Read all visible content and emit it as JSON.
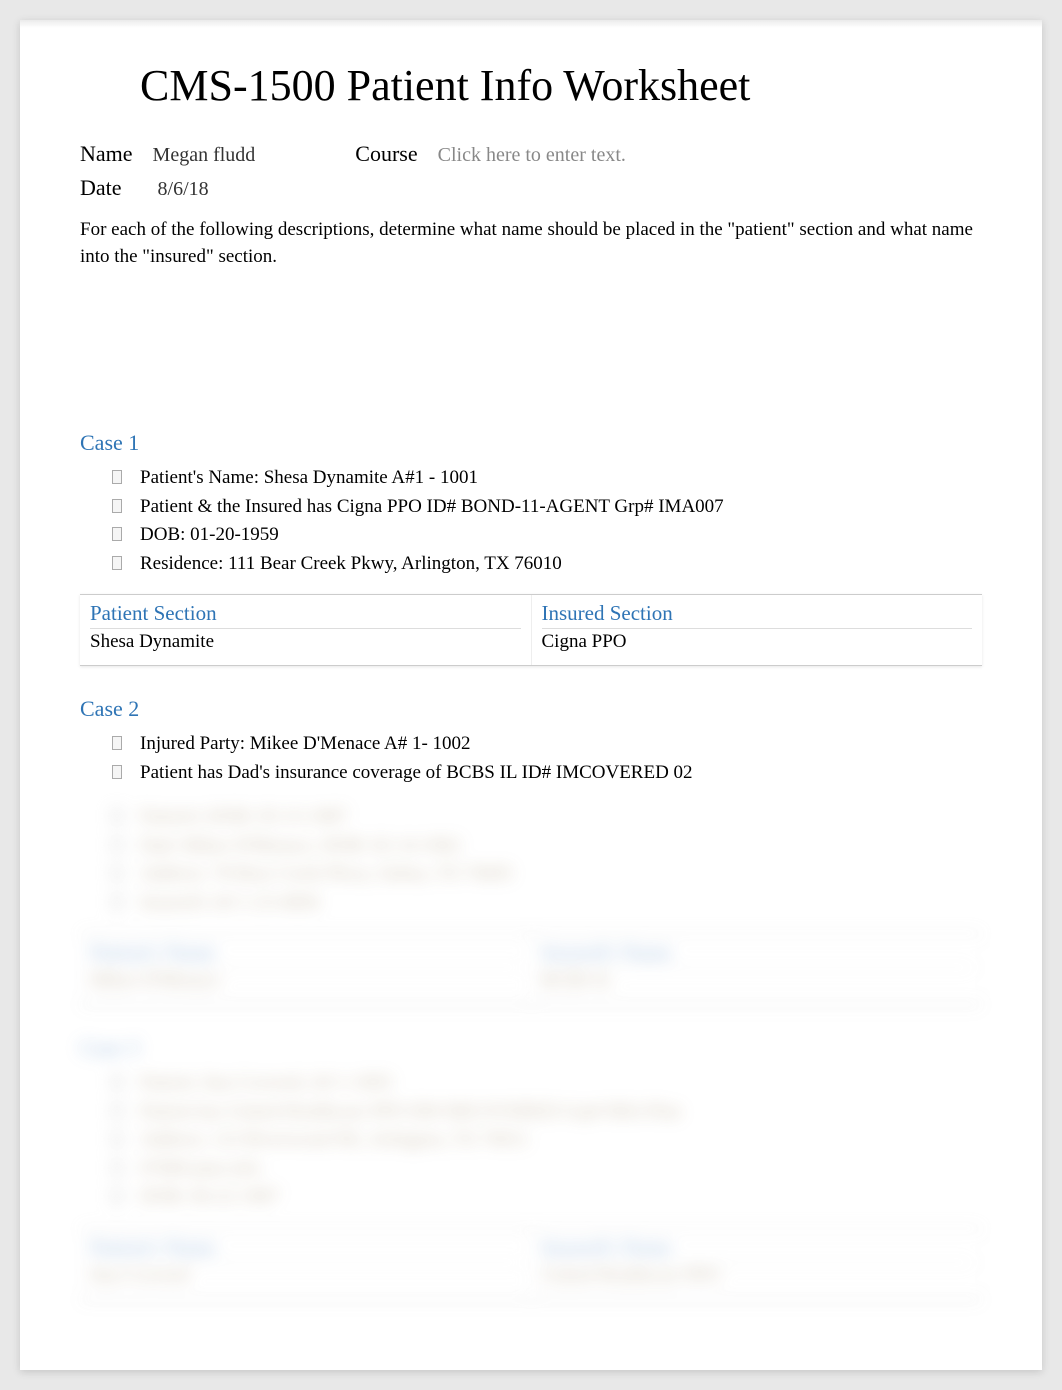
{
  "title": "CMS-1500 Patient Info Worksheet",
  "header": {
    "name_label": "Name",
    "name_value": "Megan fludd",
    "course_label": "Course",
    "course_placeholder": "Click here to enter text.",
    "date_label": "Date",
    "date_value": "8/6/18"
  },
  "instructions": "For each of the following descriptions, determine what name should be placed in the \"patient\" section and what name into the \"insured\" section.",
  "cases": [
    {
      "title": "Case 1",
      "bullets": [
        "Patient's Name:  Shesa  Dynamite    A#1 - 1001",
        "Patient & the Insured has Cigna PPO ID# BOND-11-AGENT  Grp# IMA007",
        "DOB: 01-20-1959",
        "Residence: 111 Bear Creek Pkwy, Arlington, TX 76010"
      ],
      "patient_section_label": "Patient Section",
      "patient_section_value": "Shesa Dynamite",
      "insured_section_label": "Insured Section",
      "insured_section_value": "Cigna PPO"
    },
    {
      "title": "Case 2",
      "bullets": [
        "Injured Party: Mikee D'Menace   A# 1- 1002",
        "Patient has Dad's insurance coverage of BCBS IL ID# IMCOVERED 02"
      ],
      "blurred_bullets": [
        "Patient's DOB: 05-15-1987",
        "Dad: Mikee D'Menace, DOB: 02-14-1962",
        "Address:  78 Bear Creek Pkwy, Salina, TX 76005",
        "Insured's A# 1-23-4094"
      ],
      "patient_section_label": "Patient's Name",
      "patient_section_value": "Mikee D'Menace",
      "insured_section_label": "Insured's Name",
      "insured_section_value": "BCBS IL"
    },
    {
      "title": "Case 3",
      "bullets": [
        "Patient: Ima Covered,  A# 1-1003",
        "Patient has United Healthcare PPO ID# IMCOVERED Grp# IMA Plan",
        "Address:  123 Riverwood NE, Arlington, TX 76011",
        "#7689 plan info",
        "DOB: 04-22-1987"
      ],
      "patient_section_label": "Patient's Name",
      "patient_section_value": "Ima Covered",
      "insured_section_label": "Insured's Name",
      "insured_section_value": "United Healthcare PPO"
    }
  ]
}
